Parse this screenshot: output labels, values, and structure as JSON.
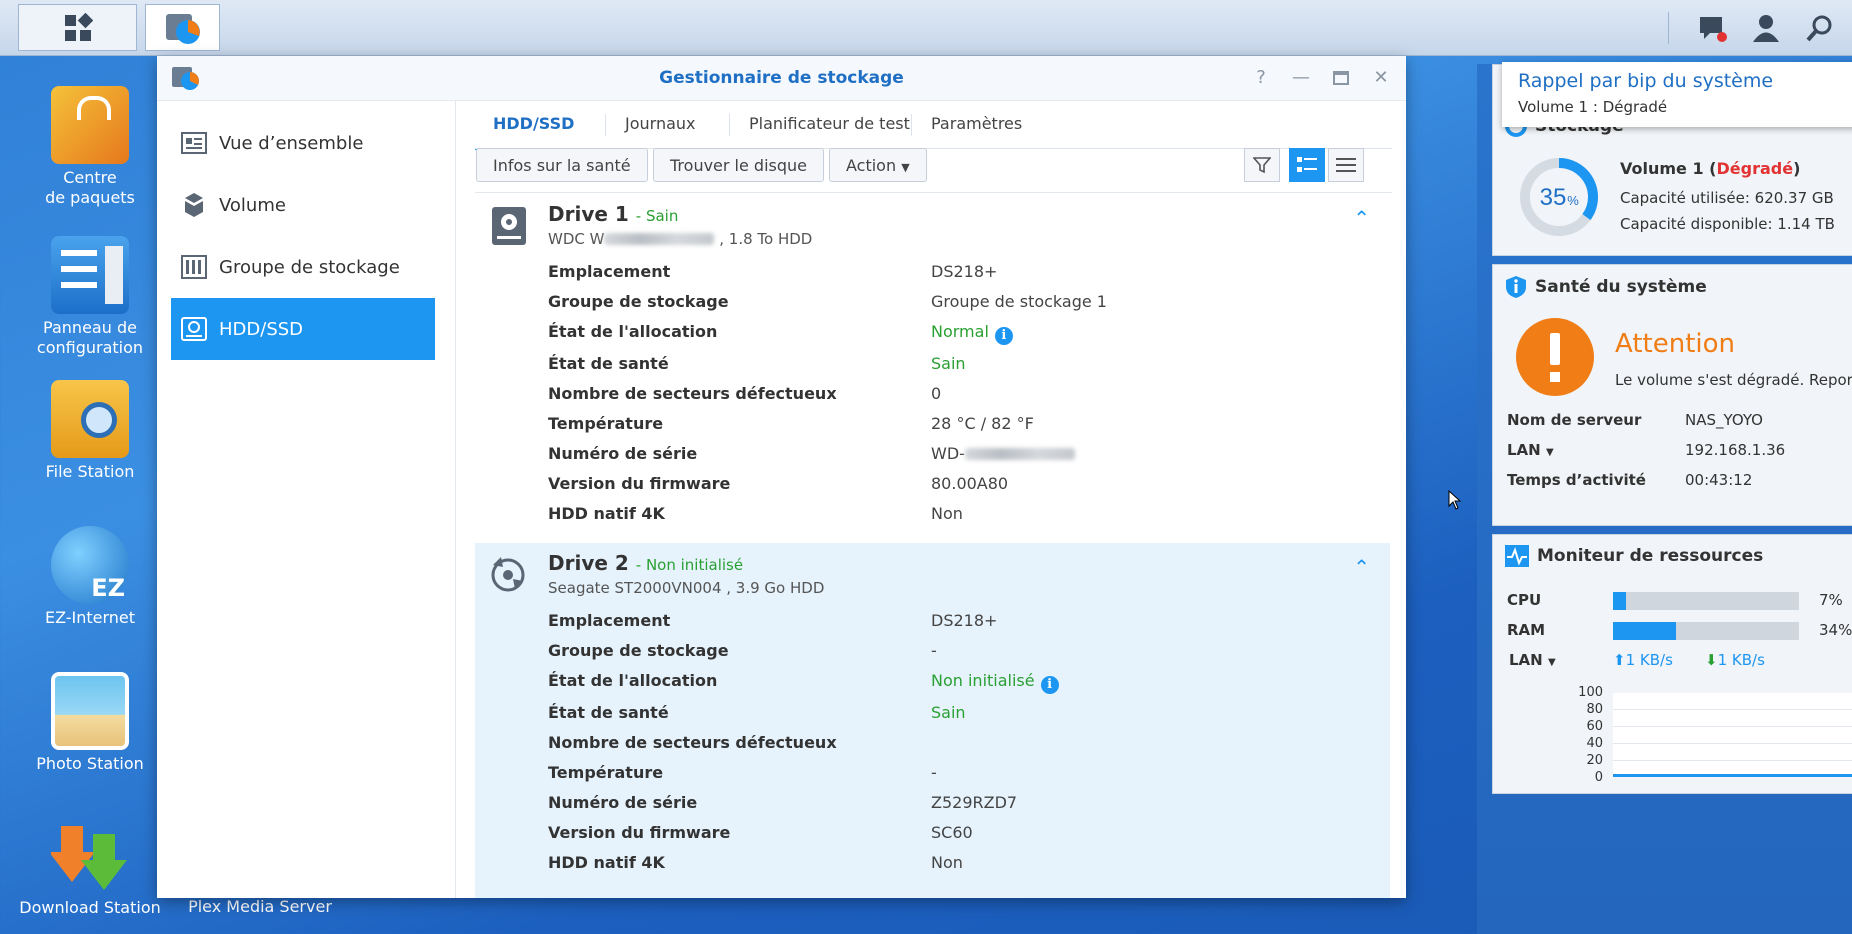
{
  "taskbar": {
    "icons": [
      "apps-grid-icon",
      "storage-manager-icon"
    ],
    "right_icons": [
      "notification-icon",
      "user-icon",
      "search-icon"
    ]
  },
  "desktop": {
    "icons": [
      {
        "label_line1": "Centre",
        "label_line2": "de paquets",
        "icon": "package-center-icon"
      },
      {
        "label_line1": "Panneau de",
        "label_line2": "configuration",
        "icon": "control-panel-icon"
      },
      {
        "label_line1": "File Station",
        "label_line2": "",
        "icon": "file-station-icon"
      },
      {
        "label_line1": "EZ-Internet",
        "label_line2": "",
        "icon": "ez-internet-icon"
      },
      {
        "label_line1": "Photo Station",
        "label_line2": "",
        "icon": "photo-station-icon"
      },
      {
        "label_line1": "Download Station",
        "label_line2": "",
        "icon": "download-station-icon"
      }
    ],
    "plex_label": "Plex Media Server"
  },
  "window": {
    "title": "Gestionnaire de stockage",
    "controls": [
      "help-icon",
      "minimize-icon",
      "maximize-icon",
      "close-icon"
    ],
    "sidebar": [
      {
        "label": "Vue d’ensemble",
        "icon": "overview-icon"
      },
      {
        "label": "Volume",
        "icon": "volume-icon"
      },
      {
        "label": "Groupe de stockage",
        "icon": "storage-pool-icon"
      },
      {
        "label": "HDD/SSD",
        "icon": "hdd-icon"
      }
    ],
    "tabs": [
      "HDD/SSD",
      "Journaux",
      "Planificateur de test",
      "Paramètres"
    ],
    "toolbar": {
      "health_info": "Infos sur la santé",
      "locate_disk": "Trouver le disque",
      "action": "Action"
    },
    "drive1": {
      "name": "Drive 1",
      "state": "- Sain",
      "model_prefix": "WDC W",
      "model_suffix": ", 1.8 To HDD",
      "rows": [
        {
          "k": "Emplacement",
          "v": "DS218+"
        },
        {
          "k": "Groupe de stockage",
          "v": "Groupe de stockage 1"
        },
        {
          "k": "État de l'allocation",
          "v": "Normal"
        },
        {
          "k": "État de santé",
          "v": "Sain"
        },
        {
          "k": "Nombre de secteurs défectueux",
          "v": "0"
        },
        {
          "k": "Température",
          "v": "28 °C / 82 °F"
        },
        {
          "k": "Numéro de série",
          "v": "WD-"
        },
        {
          "k": "Version du firmware",
          "v": "80.00A80"
        },
        {
          "k": "HDD natif 4K",
          "v": "Non"
        }
      ]
    },
    "drive2": {
      "name": "Drive 2",
      "state": "- Non initialisé",
      "model": "Seagate ST2000VN004 , 3.9 Go HDD",
      "rows": [
        {
          "k": "Emplacement",
          "v": "DS218+"
        },
        {
          "k": "Groupe de stockage",
          "v": "-"
        },
        {
          "k": "État de l'allocation",
          "v": "Non initialisé"
        },
        {
          "k": "État de santé",
          "v": "Sain"
        },
        {
          "k": "Nombre de secteurs défectueux",
          "v": ""
        },
        {
          "k": "Température",
          "v": "-"
        },
        {
          "k": "Numéro de série",
          "v": "Z529RZD7"
        },
        {
          "k": "Version du firmware",
          "v": "SC60"
        },
        {
          "k": "HDD natif 4K",
          "v": "Non"
        }
      ]
    }
  },
  "notification": {
    "title": "Rappel par bip du système",
    "text": "Volume 1 : Dégradé"
  },
  "widgets": {
    "storage": {
      "title": "Stockage",
      "percent": "35",
      "percent_unit": "%",
      "used_fraction": 0.35,
      "vol_label": "Volume 1 (",
      "vol_state": "Dégradé",
      "vol_end": ")",
      "used": "Capacité utilisée: 620.37 GB",
      "free": "Capacité disponible: 1.14 TB"
    },
    "health": {
      "title": "Santé du système",
      "status": "Attention",
      "message": "Le volume s'est dégradé. Repor",
      "server_label": "Nom de serveur",
      "server": "NAS_YOYO",
      "lan_label": "LAN",
      "lan": "192.168.1.36",
      "uptime_label": "Temps d’activité",
      "uptime": "00:43:12"
    },
    "resources": {
      "title": "Moniteur de ressources",
      "cpu_label": "CPU",
      "cpu": "7%",
      "cpu_fraction": 0.07,
      "ram_label": "RAM",
      "ram": "34%",
      "ram_fraction": 0.34,
      "lan_label": "LAN",
      "up": "1 KB/s",
      "down": "1 KB/s",
      "y_ticks": [
        "100",
        "80",
        "60",
        "40",
        "20",
        "0"
      ]
    },
    "accent": "#1d96f2",
    "warn": "#f07d16",
    "degraded": "#e23232"
  }
}
